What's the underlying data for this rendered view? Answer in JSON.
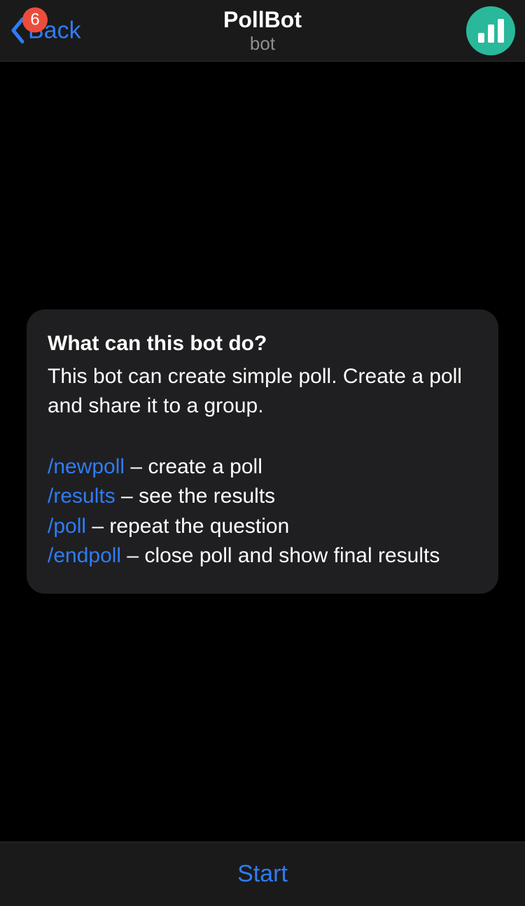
{
  "header": {
    "back_label": "Back",
    "badge_count": "6",
    "title": "PollBot",
    "subtitle": "bot",
    "avatar_icon": "bar-chart-icon"
  },
  "info": {
    "title": "What can this bot do?",
    "description": "This bot can create simple poll. Create a poll and share it to a group.",
    "commands": [
      {
        "name": "/newpoll",
        "desc": "create a poll"
      },
      {
        "name": "/results",
        "desc": "see the results"
      },
      {
        "name": "/poll",
        "desc": "repeat the question"
      },
      {
        "name": "/endpoll",
        "desc": "close poll and show final results"
      }
    ],
    "separator": " – "
  },
  "footer": {
    "start_label": "Start"
  },
  "colors": {
    "accent": "#2f7cf6",
    "badge": "#eb4d3d",
    "avatar": "#29b99a"
  }
}
